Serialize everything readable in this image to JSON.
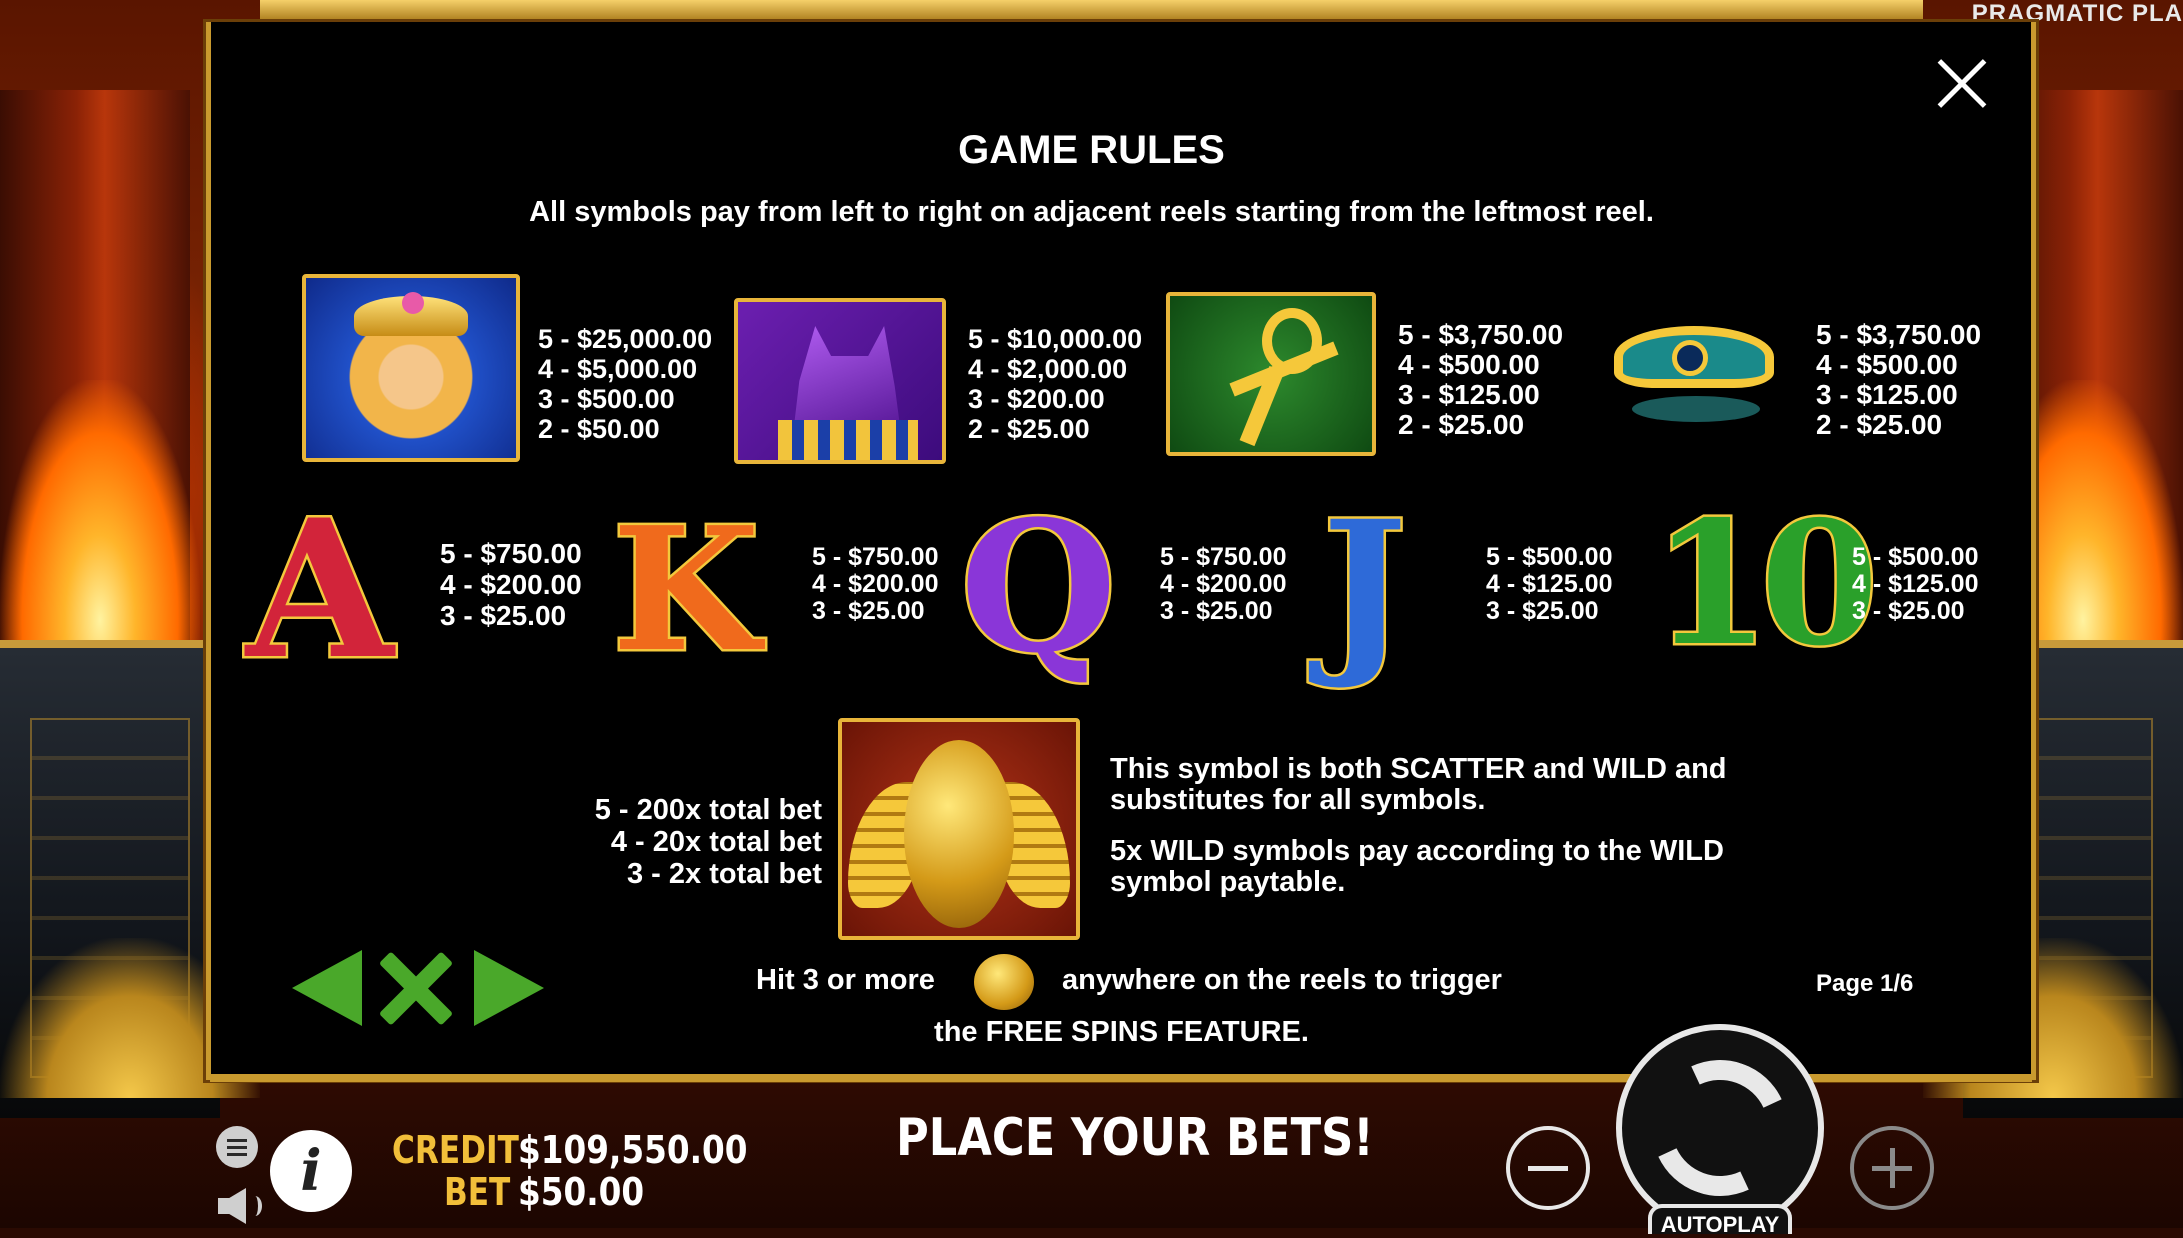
{
  "brand": "PRAGMATIC PLA",
  "rules": {
    "title": "GAME RULES",
    "subtitle": "All symbols pay from left to right on adjacent reels starting from the leftmost reel.",
    "page": "Page 1/6"
  },
  "paytable": {
    "cleopatra": [
      "5 - $25,000.00",
      "4 - $5,000.00",
      "3 - $500.00",
      "2 - $50.00"
    ],
    "anubis": [
      "5 - $10,000.00",
      "4 - $2,000.00",
      "3 - $200.00",
      "2 - $25.00"
    ],
    "ankh": [
      "5 - $3,750.00",
      "4 - $500.00",
      "3 - $125.00",
      "2 - $25.00"
    ],
    "eye": [
      "5 - $3,750.00",
      "4 - $500.00",
      "3 - $125.00",
      "2 - $25.00"
    ],
    "a": [
      "5 - $750.00",
      "4 - $200.00",
      "3 - $25.00"
    ],
    "k": [
      "5 - $750.00",
      "4 - $200.00",
      "3 - $25.00"
    ],
    "q": [
      "5 - $750.00",
      "4 - $200.00",
      "3 - $25.00"
    ],
    "j": [
      "5 - $500.00",
      "4 - $125.00",
      "3 - $25.00"
    ],
    "ten": [
      "5 - $500.00",
      "4 - $125.00",
      "3 - $25.00"
    ]
  },
  "letters": {
    "a": "A",
    "k": "K",
    "q": "Q",
    "j": "J",
    "ten": "10"
  },
  "scatter": {
    "pays": [
      "5 - 200x total bet",
      "4 - 20x total bet",
      "3 - 2x total bet"
    ],
    "desc1": "This symbol is both SCATTER and WILD and substitutes for all symbols.",
    "desc2": "5x WILD symbols pay according to the WILD symbol paytable.",
    "trigger_a": "Hit 3 or more",
    "trigger_b": "anywhere on the reels to trigger",
    "trigger_c": "the FREE SPINS FEATURE."
  },
  "bottom": {
    "credit_label": "CREDIT",
    "credit_value": "$109,550.00",
    "bet_label": "BET",
    "bet_value": "$50.00",
    "status": "PLACE YOUR BETS!",
    "autoplay": "AUTOPLAY",
    "info": "i"
  },
  "colors": {
    "frame": "#c99a2e",
    "nav": "#4aa82a",
    "label_gold": "#f2bf3a"
  },
  "icons": [
    "close-icon",
    "prev-arrow-icon",
    "close-x-icon",
    "next-arrow-icon",
    "menu-icon",
    "info-icon",
    "sound-icon",
    "minus-icon",
    "spin-icon",
    "plus-icon"
  ]
}
